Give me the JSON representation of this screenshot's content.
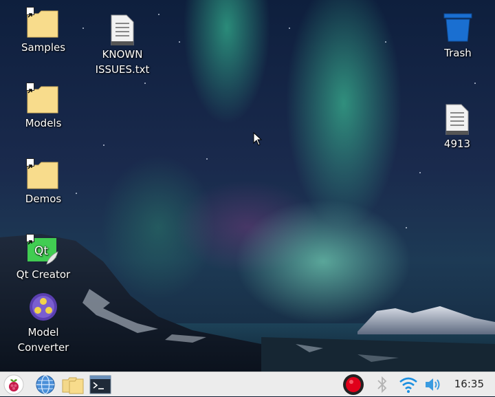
{
  "desktop": {
    "icons": [
      {
        "id": "samples",
        "label": "Samples"
      },
      {
        "id": "models",
        "label": "Models"
      },
      {
        "id": "demos",
        "label": "Demos"
      },
      {
        "id": "qt_creator",
        "label": "Qt Creator"
      },
      {
        "id": "model_converter",
        "label": "Model Converter"
      },
      {
        "id": "known_issues",
        "label": "KNOWN ISSUES.txt"
      },
      {
        "id": "trash",
        "label": "Trash"
      },
      {
        "id": "file_4913",
        "label": "4913"
      }
    ]
  },
  "taskbar": {
    "icons": [
      "raspberry-menu-icon",
      "web-browser-icon",
      "file-manager-icon",
      "terminal-icon",
      "record-icon",
      "bluetooth-icon",
      "wifi-icon",
      "volume-icon"
    ],
    "clock": "16:35"
  },
  "colors": {
    "folder": "#f8dc8c",
    "qt_green": "#41cd52",
    "trash_blue": "#1a6fd1",
    "taskbar_bg": "#ececec",
    "record_red": "#e0001a"
  }
}
